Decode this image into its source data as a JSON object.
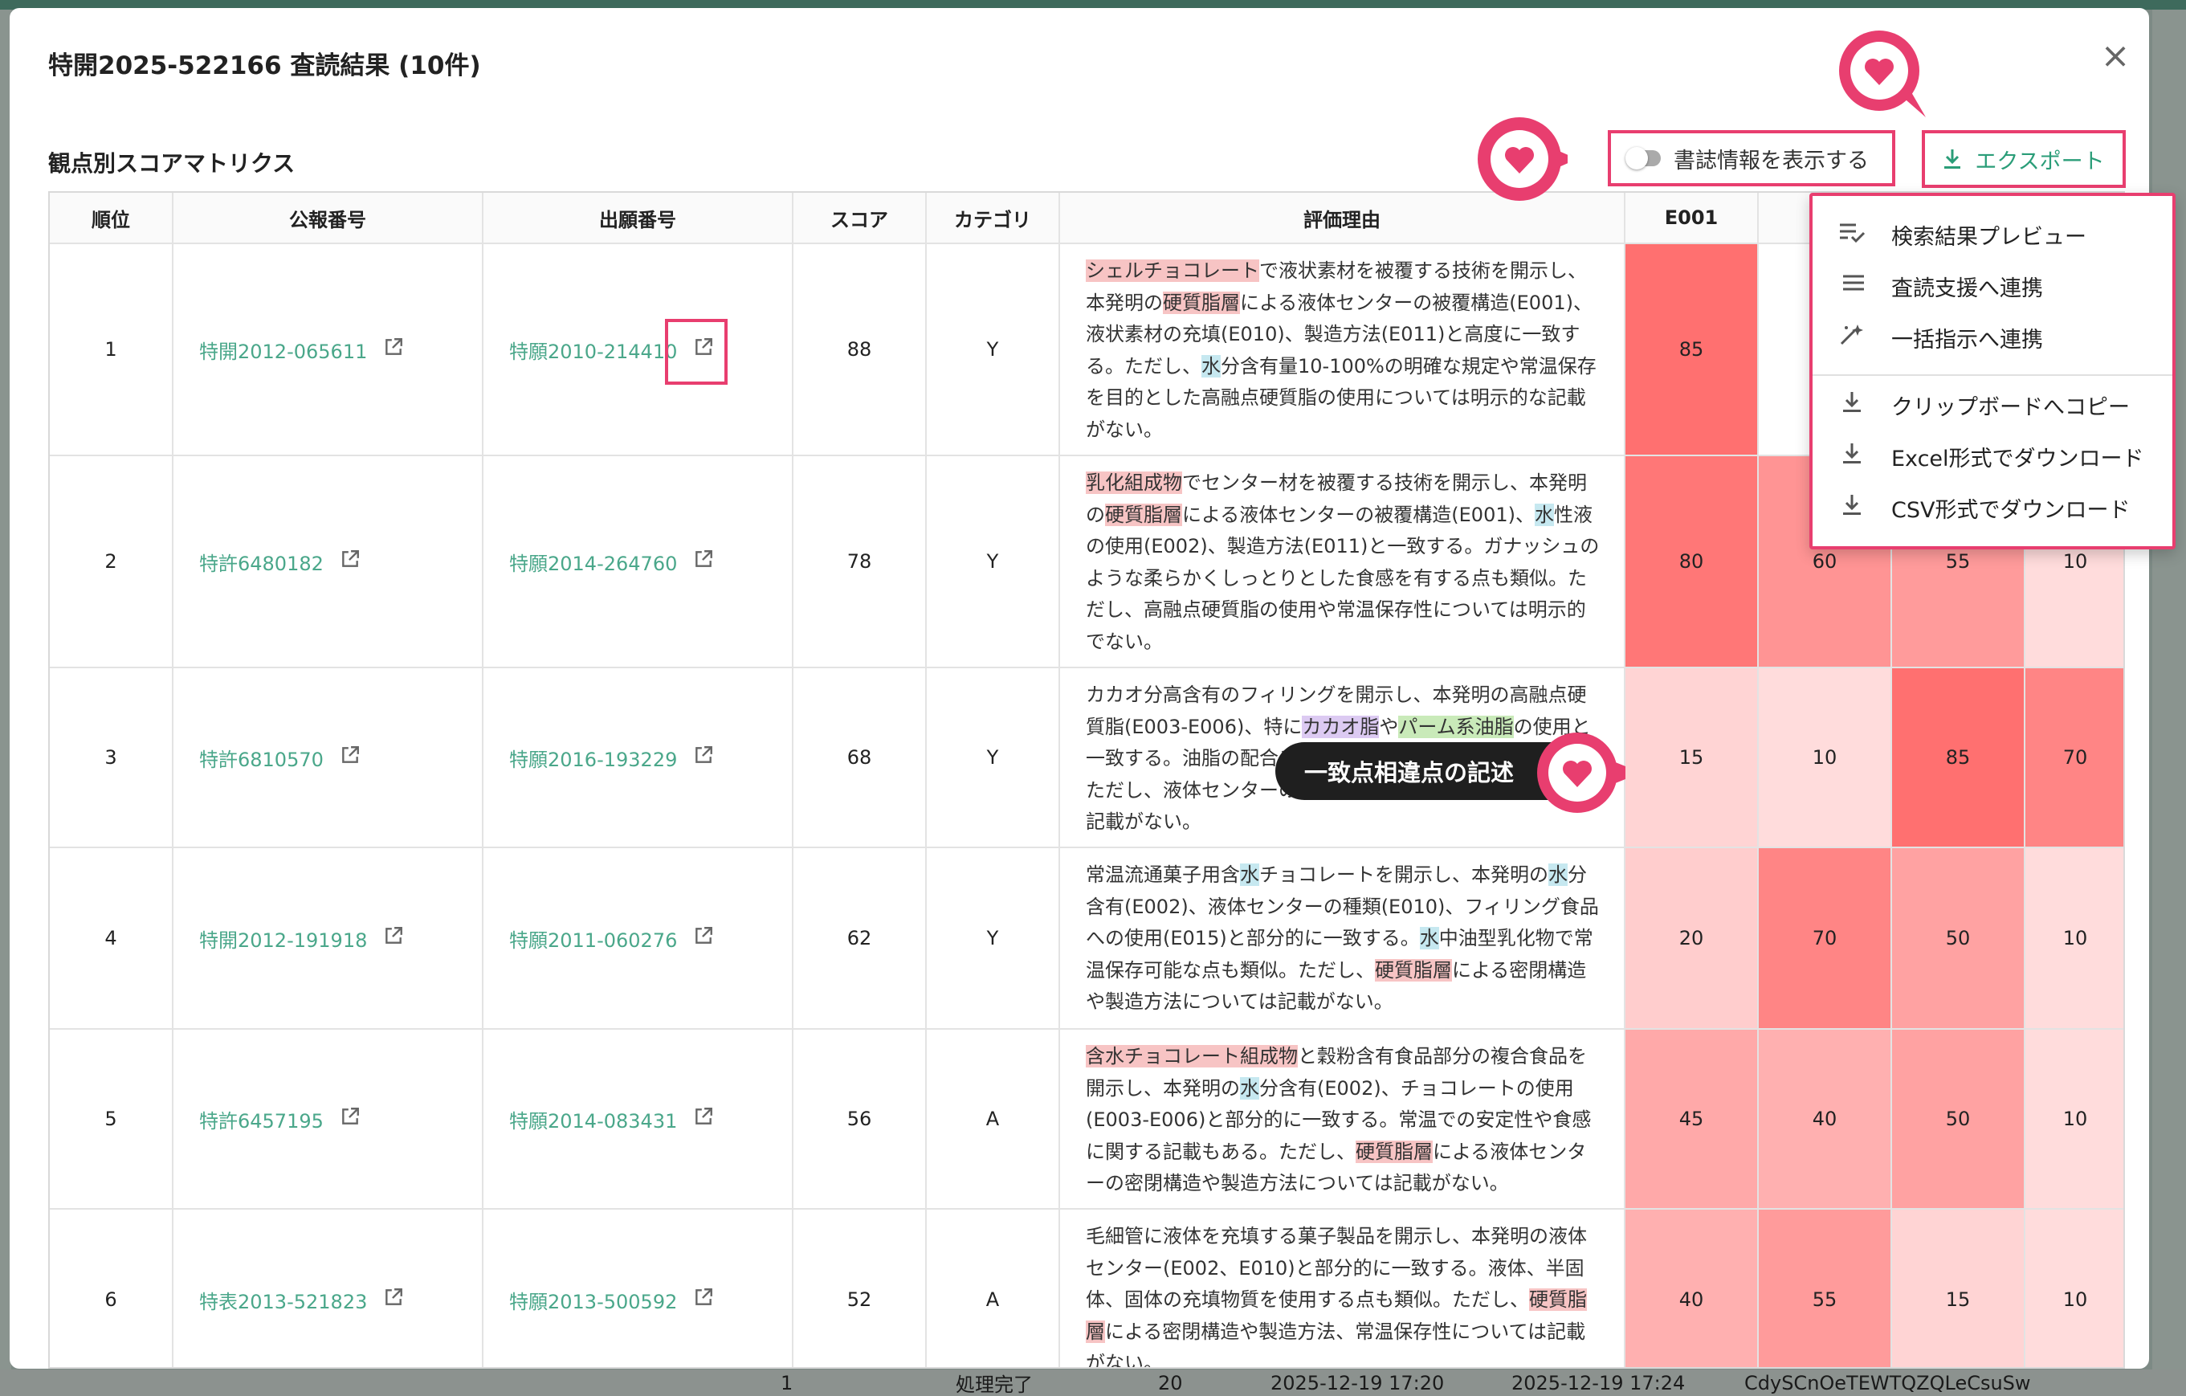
{
  "background": {
    "bottom_row": {
      "index": "1",
      "status": "処理完了",
      "count": "20",
      "start": "2025-12-19 17:20",
      "end": "2025-12-19 17:24",
      "id": "CdySCnOeTEWTQZQLeCsuSw"
    }
  },
  "modal": {
    "title": "特開2025-522166 査読結果 (10件)",
    "close_label": "×",
    "section_title": "観点別スコアマトリクス",
    "toggle_label": "書誌情報を表示する",
    "toggle_on": false,
    "export_label": "エクスポート"
  },
  "table": {
    "headers": [
      "順位",
      "公報番号",
      "出願番号",
      "スコア",
      "カテゴリ",
      "評価理由",
      "E001"
    ],
    "rows": [
      {
        "rank": "1",
        "pub": "特開2012-065611",
        "app": "特願2010-214410",
        "score": "88",
        "cat": "Y",
        "reason": [
          {
            "t": "シェルチョコレート",
            "h": "r"
          },
          {
            "t": "で液状素材を被覆する技術を開示し、本発明の"
          },
          {
            "t": "硬質脂層",
            "h": "r"
          },
          {
            "t": "による液体センターの被覆構造(E001)、液状素材の充填(E010)、製造方法(E011)と高度に一致する。ただし、"
          },
          {
            "t": "水",
            "h": "b"
          },
          {
            "t": "分含有量10-100%の明確な規定や常温保存を目的とした高融点硬質脂の使用については明示的な記載がない。"
          }
        ],
        "e": [
          "85",
          "",
          "",
          ""
        ]
      },
      {
        "rank": "2",
        "pub": "特許6480182",
        "app": "特願2014-264760",
        "score": "78",
        "cat": "Y",
        "reason": [
          {
            "t": "乳化組成物",
            "h": "r"
          },
          {
            "t": "でセンター材を被覆する技術を開示し、本発明の"
          },
          {
            "t": "硬質脂層",
            "h": "r"
          },
          {
            "t": "による液体センターの被覆構造(E001)、"
          },
          {
            "t": "水",
            "h": "b"
          },
          {
            "t": "性液の使用(E002)、製造方法(E011)と一致する。ガナッシュのような柔らかくしっとりとした食感を有する点も類似。ただし、高融点硬質脂の使用や常温保存性については明示的でない。"
          }
        ],
        "e": [
          "80",
          "60",
          "55",
          "10"
        ]
      },
      {
        "rank": "3",
        "pub": "特許6810570",
        "app": "特願2016-193229",
        "score": "68",
        "cat": "Y",
        "reason": [
          {
            "t": "カカオ分高含有のフィリングを開示し、本発明の高融点硬質脂(E003-E006)、特に"
          },
          {
            "t": "カカオ脂",
            "h": "p"
          },
          {
            "t": "や"
          },
          {
            "t": "パーム系油脂",
            "h": "g"
          },
          {
            "t": "の使用と一致する。油脂の配合や物性を調整する点も類似である。ただし、液体センターの被覆構造や常温保存性については記載がない。"
          }
        ],
        "e": [
          "15",
          "10",
          "85",
          "70"
        ]
      },
      {
        "rank": "4",
        "pub": "特開2012-191918",
        "app": "特願2011-060276",
        "score": "62",
        "cat": "Y",
        "reason": [
          {
            "t": "常温流通菓子用含"
          },
          {
            "t": "水",
            "h": "b"
          },
          {
            "t": "チョコレートを開示し、本発明の"
          },
          {
            "t": "水",
            "h": "b"
          },
          {
            "t": "分含有(E002)、液体センターの種類(E010)、フィリング食品への使用(E015)と部分的に一致する。"
          },
          {
            "t": "水",
            "h": "b"
          },
          {
            "t": "中油型乳化物で常温保存可能な点も類似。ただし、"
          },
          {
            "t": "硬質脂層",
            "h": "r"
          },
          {
            "t": "による密閉構造や製造方法については記載がない。"
          }
        ],
        "e": [
          "20",
          "70",
          "50",
          "10"
        ]
      },
      {
        "rank": "5",
        "pub": "特許6457195",
        "app": "特願2014-083431",
        "score": "56",
        "cat": "A",
        "reason": [
          {
            "t": "含水チョコレート組成物",
            "h": "r"
          },
          {
            "t": "と穀粉含有食品部分の複合食品を開示し、本発明の"
          },
          {
            "t": "水",
            "h": "b"
          },
          {
            "t": "分含有(E002)、チョコレートの使用(E003-E006)と部分的に一致する。常温での安定性や食感に関する記載もある。ただし、"
          },
          {
            "t": "硬質脂層",
            "h": "r"
          },
          {
            "t": "による液体センターの密閉構造や製造方法については記載がない。"
          }
        ],
        "e": [
          "45",
          "40",
          "50",
          "10"
        ]
      },
      {
        "rank": "6",
        "pub": "特表2013-521823",
        "app": "特願2013-500592",
        "score": "52",
        "cat": "A",
        "reason": [
          {
            "t": "毛細管に液体を充填する菓子製品を開示し、本発明の液体センター(E002、E010)と部分的に一致する。液体、半固体、固体の充填物質を使用する点も類似。ただし、"
          },
          {
            "t": "硬質脂層",
            "h": "r"
          },
          {
            "t": "による密閉構造や製造方法、常温保存性については記載がない。"
          }
        ],
        "e": [
          "40",
          "55",
          "15",
          "10"
        ]
      }
    ]
  },
  "export_menu": {
    "items": [
      {
        "label": "検索結果プレビュー",
        "icon": "list-check-icon"
      },
      {
        "label": "査読支援へ連携",
        "icon": "list-icon"
      },
      {
        "label": "一括指示へ連携",
        "icon": "sparkle-icon"
      },
      {
        "label": "クリップボードへコピー",
        "icon": "download-icon"
      },
      {
        "label": "Excel形式でダウンロード",
        "icon": "download-icon"
      },
      {
        "label": "CSV形式でダウンロード",
        "icon": "download-icon"
      }
    ]
  },
  "callout": {
    "label": "一致点相違点の記述"
  },
  "colors": {
    "accent": "#2a9d78",
    "highlight_border": "#e83e6f",
    "pin": "#e83e6f",
    "heat_max": "#ff5a5a",
    "heat_min": "#ffe8e8"
  }
}
